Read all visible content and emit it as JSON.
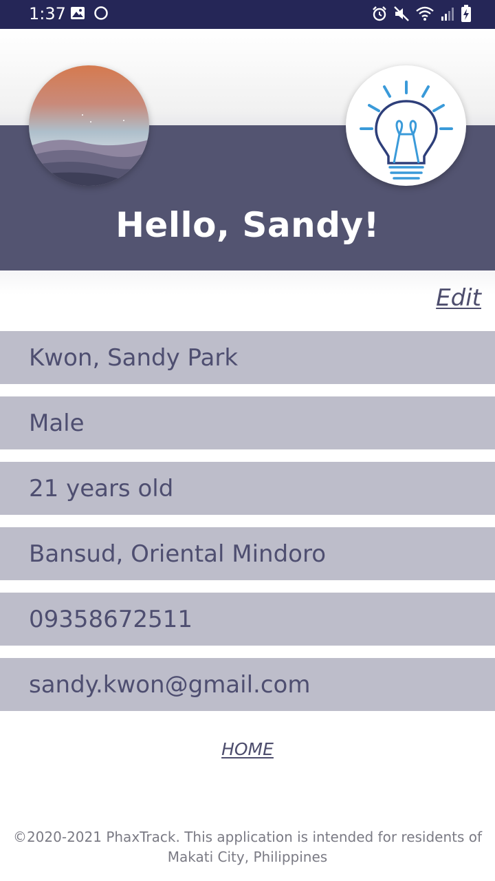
{
  "status_bar": {
    "time": "1:37",
    "left_icons": [
      "gallery-icon",
      "circle-icon"
    ],
    "right_icons": [
      "alarm-icon",
      "mute-icon",
      "wifi-icon",
      "signal-icon",
      "battery-charging-icon"
    ]
  },
  "header": {
    "greeting": "Hello, Sandy!",
    "avatar": "landscape-avatar",
    "logo": "lightbulb-icon"
  },
  "profile": {
    "edit_label": "Edit",
    "fields": [
      "Kwon, Sandy Park",
      "Male",
      "21 years old",
      "Bansud, Oriental Mindoro",
      "09358672511",
      "sandy.kwon@gmail.com"
    ]
  },
  "footer": {
    "home_label": "HOME",
    "note": "©2020-2021 PhaxTrack. This application is intended for residents of Makati City, Philippines"
  },
  "colors": {
    "status_bar": "#252657",
    "header_band": "#535471",
    "row_background": "#bdbdca",
    "row_text": "#4e4e70",
    "bulb_blue": "#3a9ad9",
    "bulb_navy": "#2e3f7a"
  }
}
